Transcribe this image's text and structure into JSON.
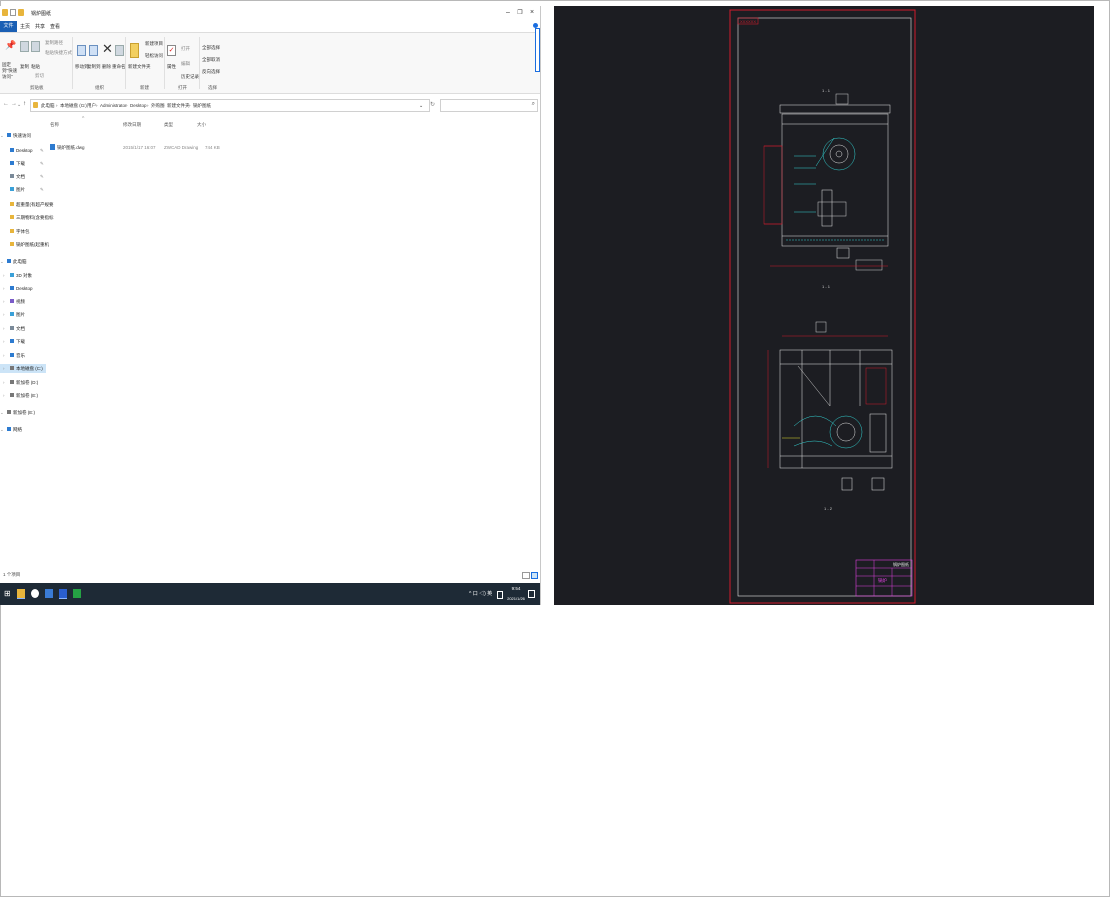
{
  "explorer": {
    "title": "锅炉图纸",
    "ribbon_tabs": [
      "文件",
      "主页",
      "共享",
      "查看"
    ],
    "ribbon": {
      "pin_label": "固定到\"快速访问\"",
      "copy_label": "复制",
      "paste_label": "粘贴",
      "copy_path_label": "复制路径",
      "paste_shortcut_label": "粘贴快捷方式",
      "cut_label": "剪切",
      "move_to_label": "移动到",
      "copy_to_label": "复制到",
      "delete_label": "删除",
      "rename_label": "重命名",
      "new_folder_label": "新建文件夹",
      "new_item_label": "新建项目",
      "easy_access_label": "轻松访问",
      "properties_label": "属性",
      "open_label": "打开",
      "edit_label": "编辑",
      "history_label": "历史记录",
      "select_all_label": "全部选择",
      "select_none_label": "全部取消",
      "invert_label": "反向选择",
      "groups": [
        "剪贴板",
        "组织",
        "新建",
        "打开",
        "选择"
      ]
    },
    "breadcrumbs": [
      "此电脑",
      "本地磁盘 (C:)",
      "用户",
      "Administrator",
      "Desktop",
      "外购图",
      "新建文件夹",
      "锅炉图纸"
    ],
    "columns": [
      "名称",
      "修改日期",
      "类型",
      "大小"
    ],
    "files": [
      {
        "name": "锅炉图纸.dwg",
        "modified": "2015/1/17 16:07",
        "type": "ZWCAD Drawing",
        "size": "744 KB"
      }
    ],
    "sidebar": [
      {
        "label": "快速访问",
        "kind": "head",
        "icon": "star-icon"
      },
      {
        "label": "Desktop",
        "kind": "pinned",
        "icon": "desktop-icon"
      },
      {
        "label": "下载",
        "kind": "pinned",
        "icon": "download-icon"
      },
      {
        "label": "文档",
        "kind": "pinned",
        "icon": "document-icon"
      },
      {
        "label": "图片",
        "kind": "pinned",
        "icon": "picture-icon"
      },
      {
        "label": "超重量(有超产规要",
        "kind": "folder",
        "icon": "folder-icon"
      },
      {
        "label": "三期物料(含要指标",
        "kind": "folder",
        "icon": "folder-icon"
      },
      {
        "label": "字体包",
        "kind": "folder",
        "icon": "folder-icon"
      },
      {
        "label": "锅炉图纸(起重机",
        "kind": "folder",
        "icon": "folder-icon"
      },
      {
        "label": "此电脑",
        "kind": "head",
        "icon": "computer-icon"
      },
      {
        "label": "3D 对象",
        "kind": "item",
        "icon": "cube-icon"
      },
      {
        "label": "Desktop",
        "kind": "item",
        "icon": "desktop-icon"
      },
      {
        "label": "视频",
        "kind": "item",
        "icon": "video-icon"
      },
      {
        "label": "图片",
        "kind": "item",
        "icon": "picture-icon"
      },
      {
        "label": "文档",
        "kind": "item",
        "icon": "document-icon"
      },
      {
        "label": "下载",
        "kind": "item",
        "icon": "download-icon"
      },
      {
        "label": "音乐",
        "kind": "item",
        "icon": "music-icon"
      },
      {
        "label": "本地磁盘 (C:)",
        "kind": "selected",
        "icon": "drive-icon"
      },
      {
        "label": "新加卷 (D:)",
        "kind": "item",
        "icon": "drive-icon"
      },
      {
        "label": "新加卷 (E:)",
        "kind": "item",
        "icon": "drive-icon"
      },
      {
        "label": "新加卷 (E:)",
        "kind": "head",
        "icon": "drive-icon"
      },
      {
        "label": "网络",
        "kind": "head",
        "icon": "network-icon"
      }
    ],
    "status": "1 个项目"
  },
  "taskbar": {
    "time": "9:54",
    "date": "2021/1/26",
    "tray": "^ 口 ◁) 英",
    "colors": {
      "bg": "#1e2a36"
    }
  },
  "cad": {
    "colors": {
      "bg": "#1c1d22",
      "frame": "#d01c2c",
      "line": "#e8e8e8",
      "cyan": "#33d6d6",
      "magenta": "#e040e0"
    },
    "view_top_label": "1 - 1",
    "view_top_bottom_label": "1 - 1",
    "view_bottom_label": "1 - 2",
    "corner_tag": "XXXXXX",
    "titleblock_main": "锅炉图纸",
    "titleblock_name": "锅炉"
  }
}
